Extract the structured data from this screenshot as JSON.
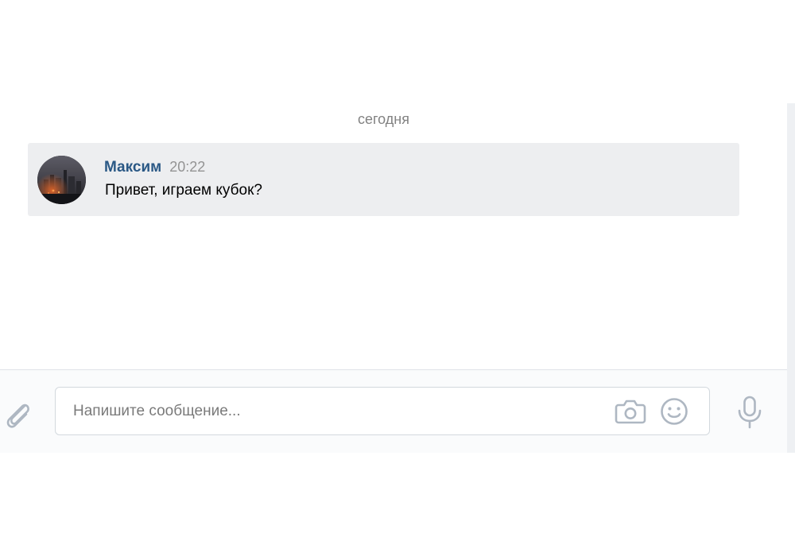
{
  "conversation": {
    "date_separator": "сегодня",
    "messages": [
      {
        "author": "Максим",
        "time": "20:22",
        "text": "Привет, играем кубок?",
        "avatar": "avatar-photo"
      }
    ]
  },
  "composer": {
    "placeholder": "Напишите сообщение...",
    "value": ""
  },
  "icons": {
    "attach": "paperclip-icon",
    "camera": "camera-icon",
    "emoji": "smile-icon",
    "mic": "microphone-icon"
  },
  "colors": {
    "author_name": "#2a5885",
    "message_background": "#edeef0",
    "icon_gray": "#aeb7c2",
    "timestamp": "#939393"
  }
}
